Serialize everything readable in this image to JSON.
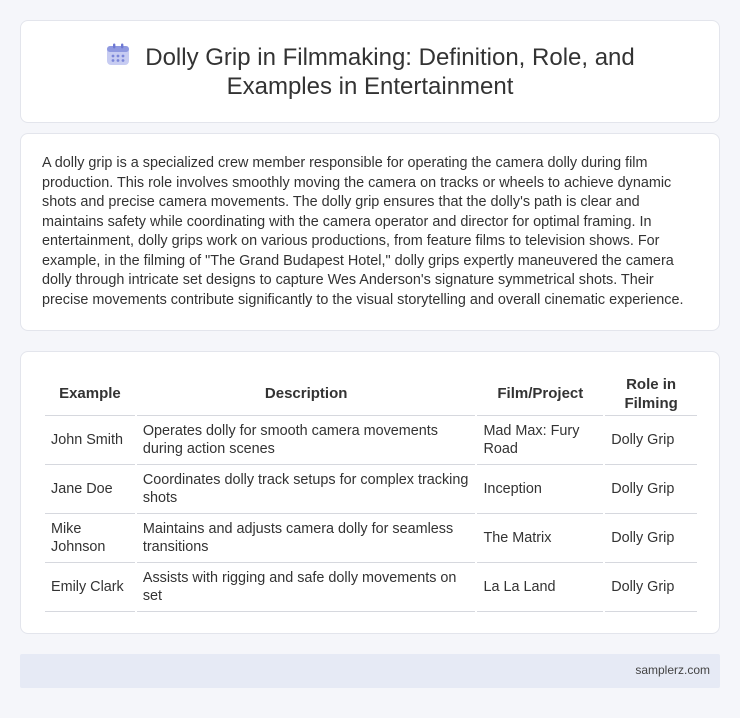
{
  "header": {
    "icon": "calendar-icon",
    "title": "Dolly Grip in Filmmaking: Definition, Role, and Examples in Entertainment"
  },
  "intro": {
    "text": "A dolly grip is a specialized crew member responsible for operating the camera dolly during film production. This role involves smoothly moving the camera on tracks or wheels to achieve dynamic shots and precise camera movements. The dolly grip ensures that the dolly's path is clear and maintains safety while coordinating with the camera operator and director for optimal framing. In entertainment, dolly grips work on various productions, from feature films to television shows. For example, in the filming of \"The Grand Budapest Hotel,\" dolly grips expertly maneuvered the camera dolly through intricate set designs to capture Wes Anderson's signature symmetrical shots. Their precise movements contribute significantly to the visual storytelling and overall cinematic experience."
  },
  "table": {
    "headers": [
      "Example",
      "Description",
      "Film/Project",
      "Role in Filming"
    ],
    "rows": [
      {
        "example": "John Smith",
        "description": "Operates dolly for smooth camera movements during action scenes",
        "film": "Mad Max: Fury Road",
        "role": "Dolly Grip"
      },
      {
        "example": "Jane Doe",
        "description": "Coordinates dolly track setups for complex tracking shots",
        "film": "Inception",
        "role": "Dolly Grip"
      },
      {
        "example": "Mike Johnson",
        "description": "Maintains and adjusts camera dolly for seamless transitions",
        "film": "The Matrix",
        "role": "Dolly Grip"
      },
      {
        "example": "Emily Clark",
        "description": "Assists with rigging and safe dolly movements on set",
        "film": "La La Land",
        "role": "Dolly Grip"
      }
    ]
  },
  "footer": {
    "text": "samplerz.com"
  },
  "colors": {
    "icon_accent": "#7b86d9",
    "footer_bg": "#e6eaf5"
  }
}
